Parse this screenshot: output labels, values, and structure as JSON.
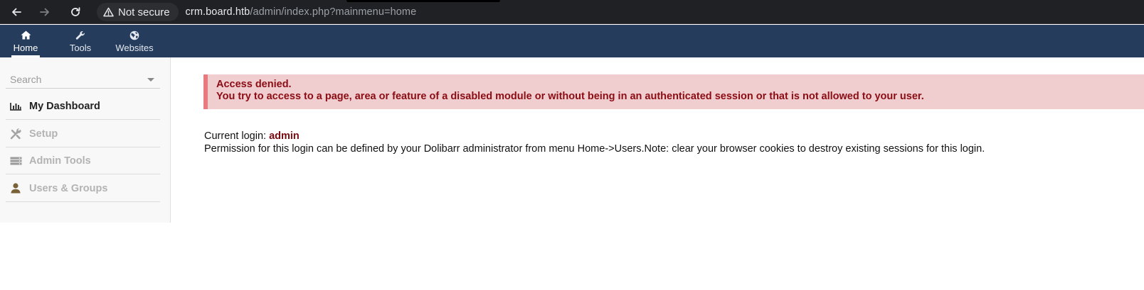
{
  "browser": {
    "security_label": "Not secure",
    "url_host": "crm.board.htb",
    "url_path": "/admin/index.php?mainmenu=home",
    "icons": [
      "back-arrow-icon",
      "forward-arrow-icon",
      "reload-icon",
      "warning-triangle-icon"
    ]
  },
  "topmenu": {
    "items": [
      {
        "label": "Home",
        "icon": "home-icon",
        "active": true
      },
      {
        "label": "Tools",
        "icon": "wrench-icon",
        "active": false
      },
      {
        "label": "Websites",
        "icon": "globe-icon",
        "active": false
      }
    ]
  },
  "sidebar": {
    "search_placeholder": "Search",
    "items": [
      {
        "label": "My Dashboard",
        "icon": "chart-bar-icon",
        "active": true
      },
      {
        "label": "Setup",
        "icon": "tools-icon",
        "active": false
      },
      {
        "label": "Admin Tools",
        "icon": "server-icon",
        "active": false
      },
      {
        "label": "Users & Groups",
        "icon": "user-icon",
        "active": false
      }
    ]
  },
  "alert": {
    "title": "Access denied.",
    "message": "You try to access to a page, area or feature of a disabled module or without being in an authenticated session or that is not allowed to your user."
  },
  "login": {
    "label": "Current login:",
    "name": "admin",
    "permission_note": "Permission for this login can be defined by your Dolibarr administrator from menu Home->Users.Note: clear your browser cookies to destroy existing sessions for this login."
  },
  "colors": {
    "topmenu_bg": "#263c5c",
    "alert_bg": "#f0cdcf",
    "alert_border": "#e8797f",
    "alert_text": "#8b0d14"
  }
}
